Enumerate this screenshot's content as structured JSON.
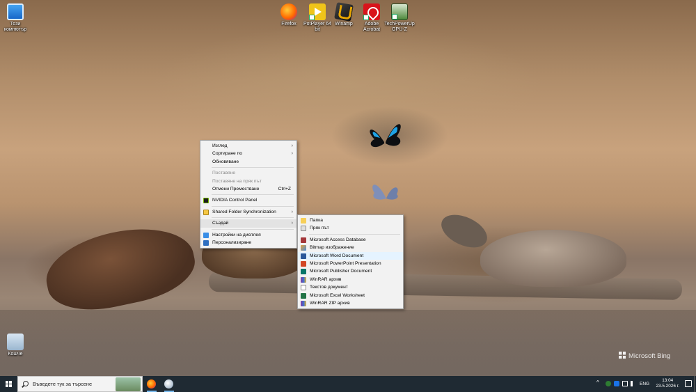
{
  "desktop": {
    "icons": [
      {
        "label": "Този компютър",
        "icon": "computer-icon"
      },
      {
        "label": "Firefox",
        "icon": "firefox-icon"
      },
      {
        "label": "PotPlayer 64 bit",
        "icon": "potplayer-icon"
      },
      {
        "label": "Winamp",
        "icon": "winamp-icon"
      },
      {
        "label": "Adobe Acrobat",
        "icon": "acrobat-icon"
      },
      {
        "label": "TechPowerUp GPU-Z",
        "icon": "gpuz-icon"
      },
      {
        "label": "Кошче",
        "icon": "recycle-bin-icon"
      }
    ],
    "watermark": "Microsoft Bing"
  },
  "context_menu": {
    "items": [
      {
        "label": "Изглед",
        "submenu": true
      },
      {
        "label": "Сортиране по",
        "submenu": true
      },
      {
        "label": "Обновяване"
      },
      {
        "label": "Поставяне",
        "disabled": true
      },
      {
        "label": "Поставяне на пряк път",
        "disabled": true
      },
      {
        "label": "Отмени Преместване",
        "shortcut": "Ctrl+Z"
      },
      {
        "label": "NVIDIA Control Panel",
        "icon": "nvidia-icon"
      },
      {
        "label": "Shared Folder Synchronization",
        "icon": "shared-folder-icon",
        "submenu": true
      },
      {
        "label": "Създай",
        "submenu": true,
        "hover": true
      },
      {
        "label": "Настройки на дисплея",
        "icon": "display-icon"
      },
      {
        "label": "Персонализиране",
        "icon": "personalize-icon"
      }
    ],
    "arrow_glyph": "›"
  },
  "new_submenu": {
    "items": [
      {
        "label": "Папка",
        "icon": "folder-icon"
      },
      {
        "label": "Пряк път",
        "icon": "shortcut-icon"
      },
      {
        "label": "Microsoft Access Database",
        "icon": "access-icon"
      },
      {
        "label": "Bitmap изображение",
        "icon": "bitmap-icon"
      },
      {
        "label": "Microsoft Word Document",
        "icon": "word-icon",
        "highlight": true
      },
      {
        "label": "Microsoft PowerPoint Presentation",
        "icon": "powerpoint-icon"
      },
      {
        "label": "Microsoft Publisher Document",
        "icon": "publisher-icon"
      },
      {
        "label": "WinRAR архив",
        "icon": "winrar-icon"
      },
      {
        "label": "Текстов документ",
        "icon": "text-document-icon"
      },
      {
        "label": "Microsoft Excel Worksheet",
        "icon": "excel-icon"
      },
      {
        "label": "WinRAR ZIP архив",
        "icon": "winrar-zip-icon"
      }
    ]
  },
  "taskbar": {
    "search_placeholder": "Въведете тук за търсене",
    "apps": [
      {
        "name": "firefox",
        "icon": "firefox-icon",
        "active": true
      },
      {
        "name": "paint",
        "icon": "paint-icon",
        "active": true
      }
    ],
    "tray": {
      "language": "ENG",
      "time": "13:04",
      "date": "23.5.2026 г."
    }
  },
  "colors": {
    "taskbar_bg": "#1f2a33",
    "menu_bg": "#f2f2f2",
    "menu_hover": "#e3e3e3",
    "menu_highlight": "#e5f3ff"
  }
}
